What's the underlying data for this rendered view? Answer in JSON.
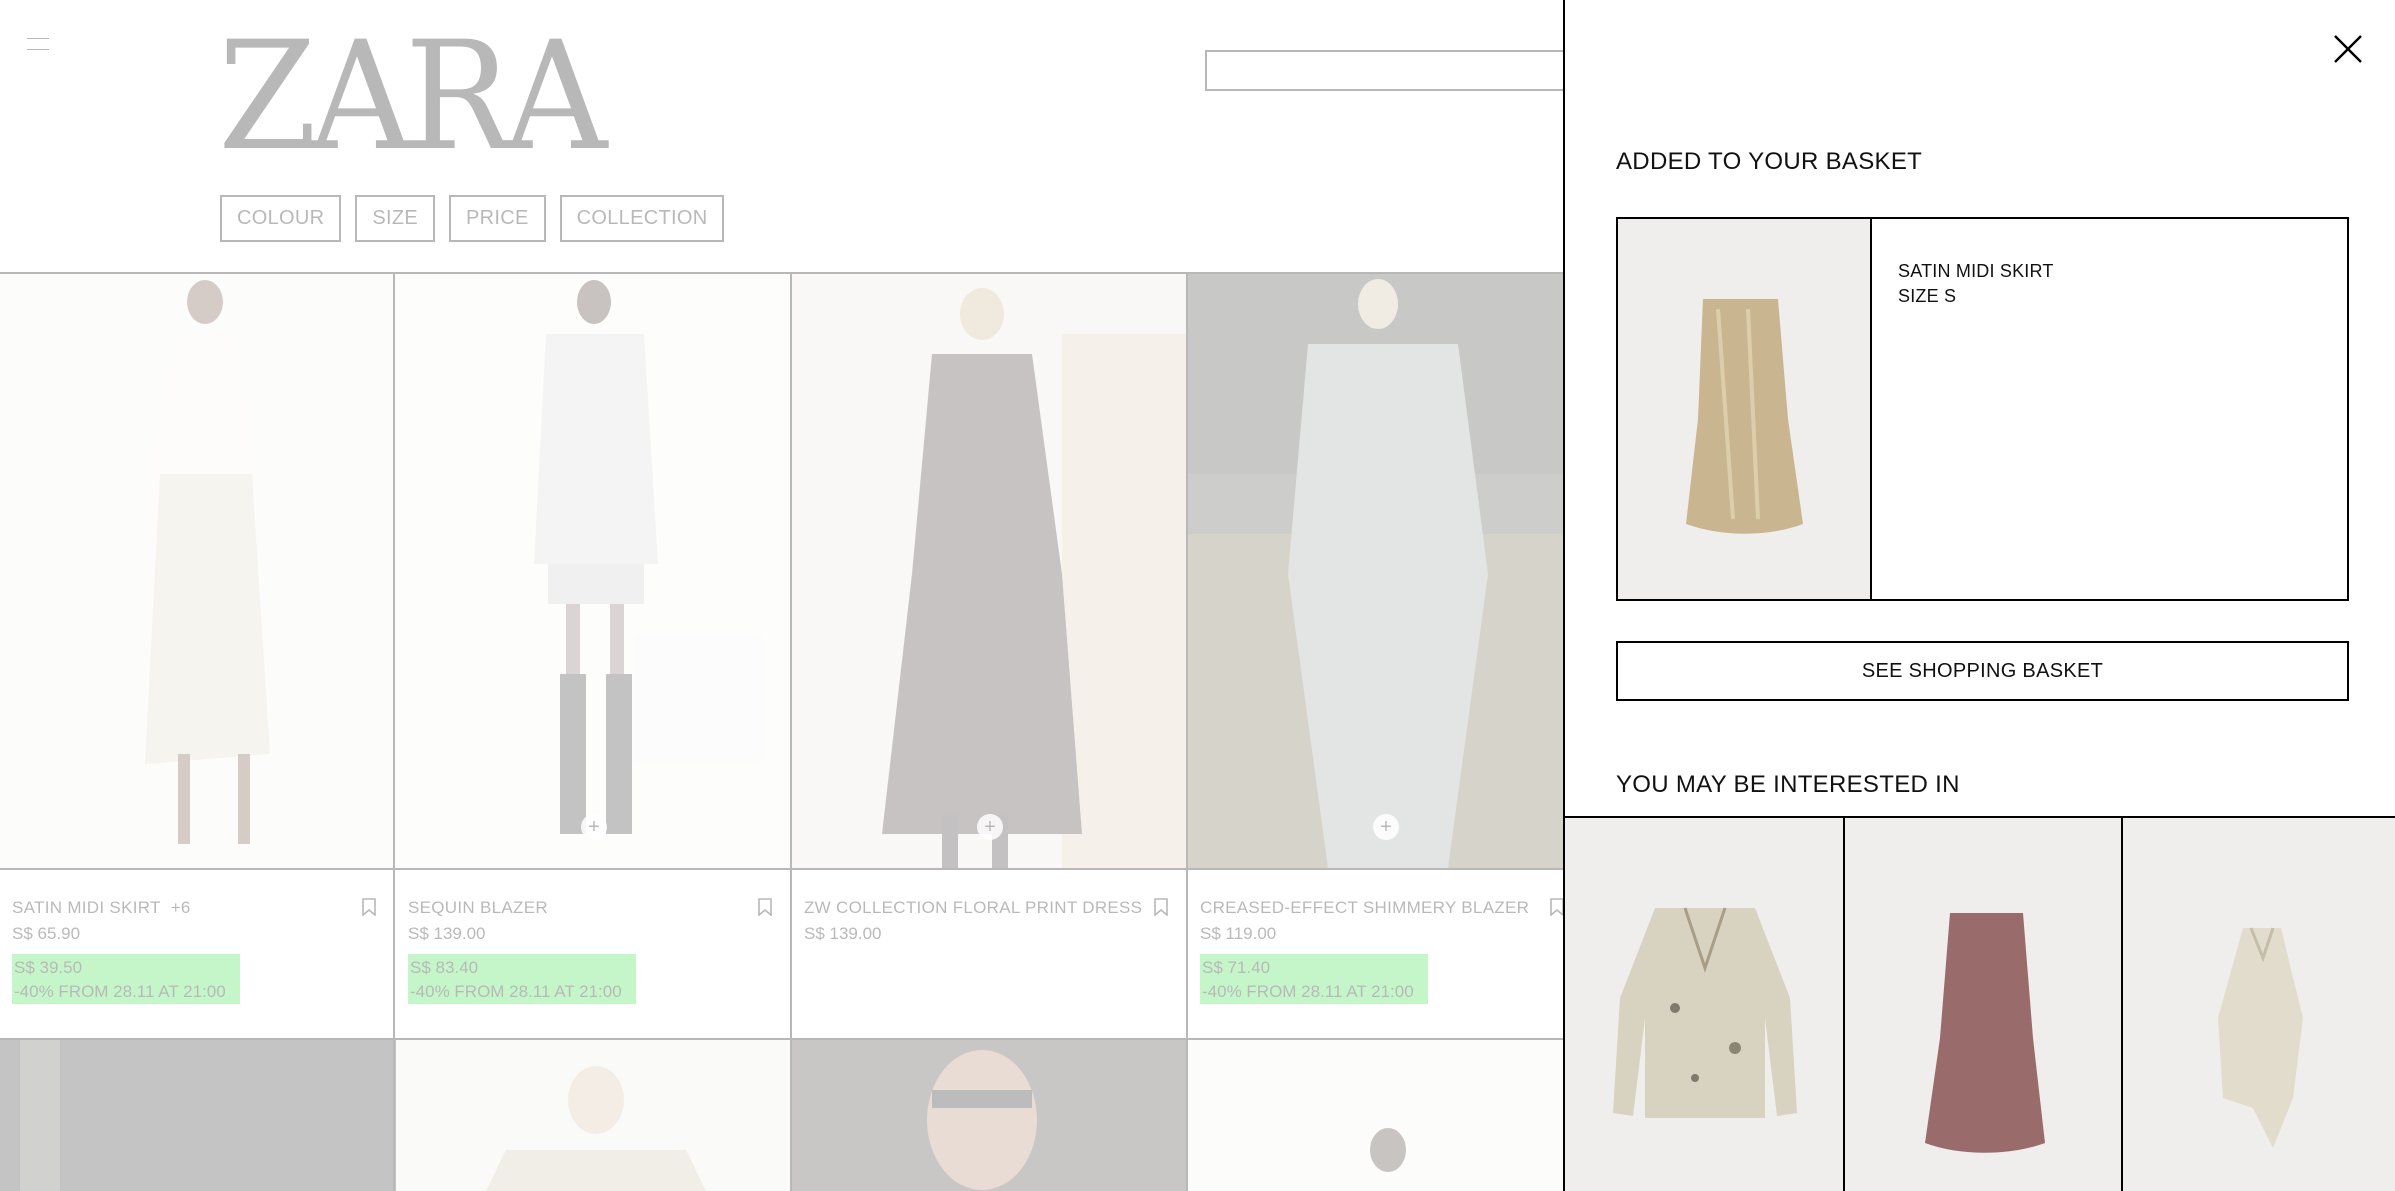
{
  "brand": {
    "logo": "ZARA"
  },
  "filters": [
    "COLOUR",
    "SIZE",
    "PRICE",
    "COLLECTION"
  ],
  "products": [
    {
      "name": "SATIN MIDI SKIRT",
      "extra_colours": "+6",
      "price": "S$ 65.90",
      "sale_price": "S$ 39.50",
      "sale_note": "-40% FROM 28.11 AT 21:00"
    },
    {
      "name": "SEQUIN BLAZER",
      "extra_colours": "",
      "price": "S$ 139.00",
      "sale_price": "S$ 83.40",
      "sale_note": "-40% FROM 28.11 AT 21:00"
    },
    {
      "name": "ZW COLLECTION FLORAL PRINT DRESS",
      "extra_colours": "",
      "price": "S$ 139.00",
      "sale_price": "",
      "sale_note": ""
    },
    {
      "name": "CREASED-EFFECT SHIMMERY BLAZER",
      "extra_colours": "",
      "price": "S$ 119.00",
      "sale_price": "S$ 71.40",
      "sale_note": "-40% FROM 28.11 AT 21:00"
    }
  ],
  "panel": {
    "heading": "ADDED TO YOUR BASKET",
    "item_name": "SATIN MIDI SKIRT",
    "item_size": "SIZE S",
    "basket_button": "SEE SHOPPING BASKET",
    "rec_heading": "YOU MAY BE INTERESTED IN"
  },
  "colors": {
    "promo": "#2fdd3f",
    "veil": "#ffffff"
  }
}
